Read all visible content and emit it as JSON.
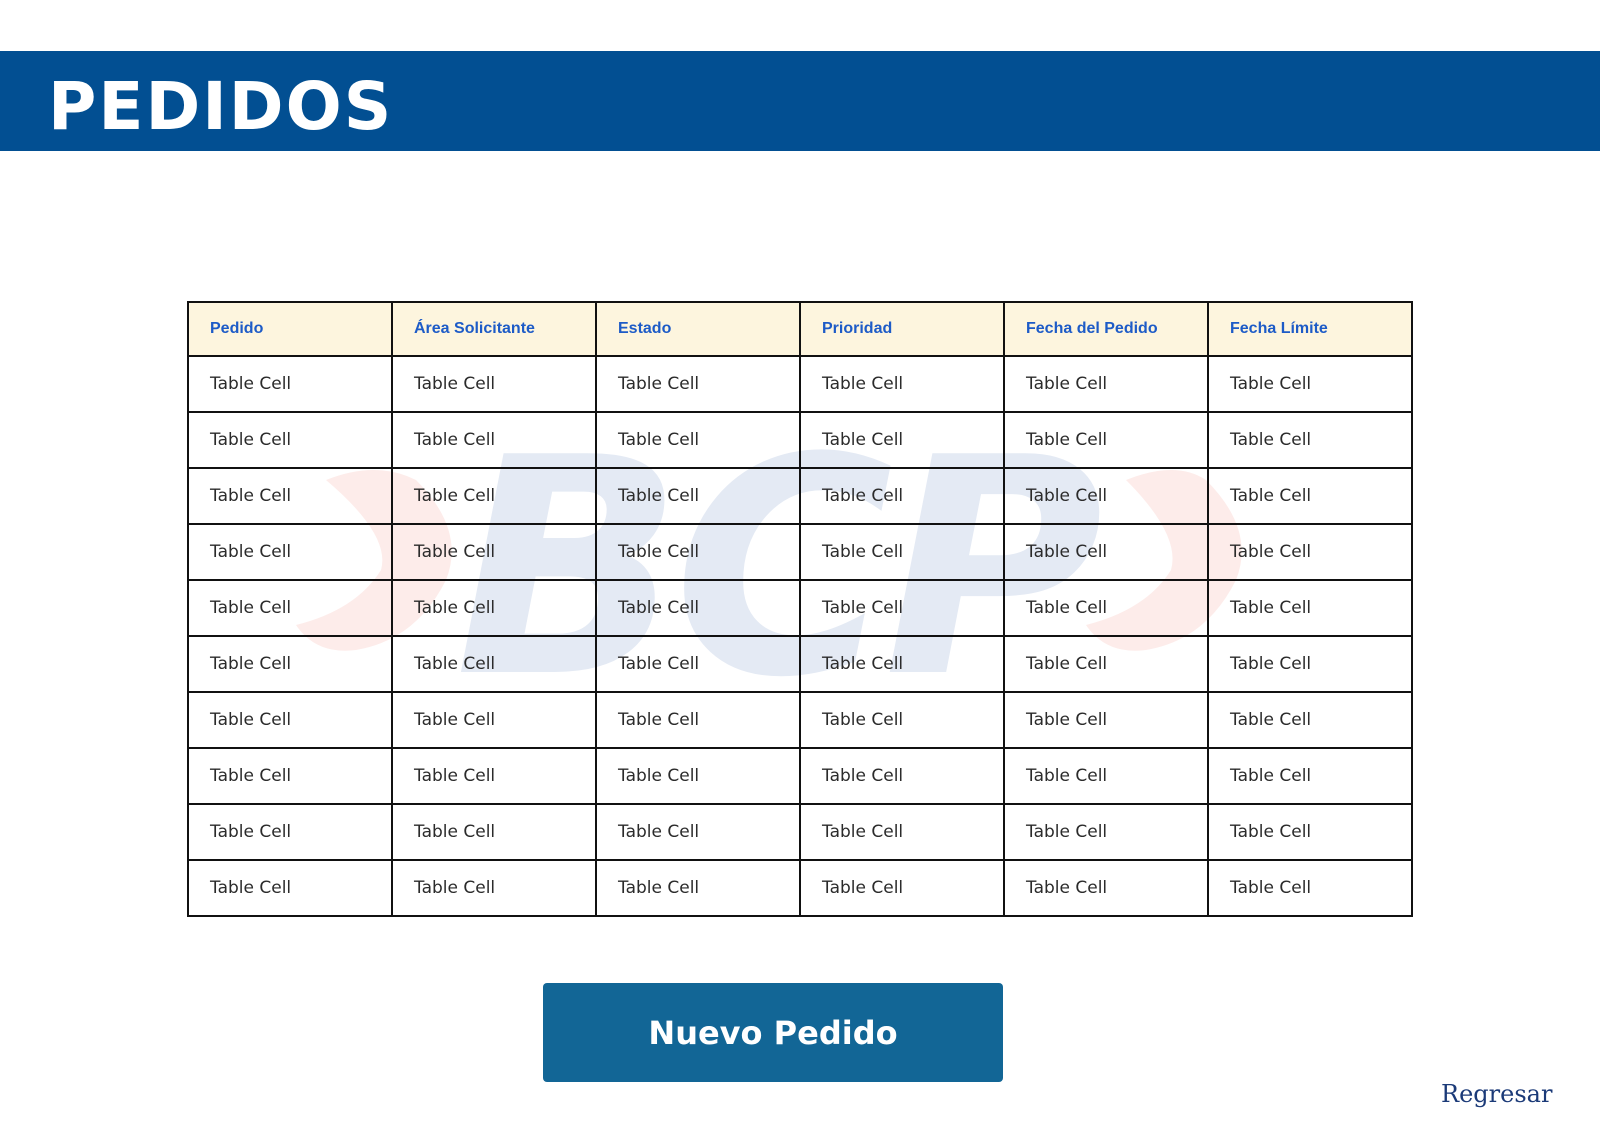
{
  "header": {
    "title": "PEDIDOS"
  },
  "watermark": {
    "text": "BCP",
    "colors": {
      "letters": "#e4eaf4",
      "chevrons": "#fdecea"
    }
  },
  "orders_table": {
    "columns": [
      "Pedido",
      "Área Solicitante",
      "Estado",
      "Prioridad",
      "Fecha del Pedido",
      "Fecha Límite"
    ],
    "rows": [
      [
        "Table Cell",
        "Table Cell",
        "Table Cell",
        "Table Cell",
        "Table Cell",
        "Table Cell"
      ],
      [
        "Table Cell",
        "Table Cell",
        "Table Cell",
        "Table Cell",
        "Table Cell",
        "Table Cell"
      ],
      [
        "Table Cell",
        "Table Cell",
        "Table Cell",
        "Table Cell",
        "Table Cell",
        "Table Cell"
      ],
      [
        "Table Cell",
        "Table Cell",
        "Table Cell",
        "Table Cell",
        "Table Cell",
        "Table Cell"
      ],
      [
        "Table Cell",
        "Table Cell",
        "Table Cell",
        "Table Cell",
        "Table Cell",
        "Table Cell"
      ],
      [
        "Table Cell",
        "Table Cell",
        "Table Cell",
        "Table Cell",
        "Table Cell",
        "Table Cell"
      ],
      [
        "Table Cell",
        "Table Cell",
        "Table Cell",
        "Table Cell",
        "Table Cell",
        "Table Cell"
      ],
      [
        "Table Cell",
        "Table Cell",
        "Table Cell",
        "Table Cell",
        "Table Cell",
        "Table Cell"
      ],
      [
        "Table Cell",
        "Table Cell",
        "Table Cell",
        "Table Cell",
        "Table Cell",
        "Table Cell"
      ],
      [
        "Table Cell",
        "Table Cell",
        "Table Cell",
        "Table Cell",
        "Table Cell",
        "Table Cell"
      ]
    ]
  },
  "actions": {
    "new_order_label": "Nuevo Pedido",
    "back_label": "Regresar"
  },
  "colors": {
    "header_bg": "#024f92",
    "table_header_bg": "#fdf5de",
    "table_header_text": "#1d5bc7",
    "button_bg": "#126696",
    "link": "#1b3a78"
  }
}
